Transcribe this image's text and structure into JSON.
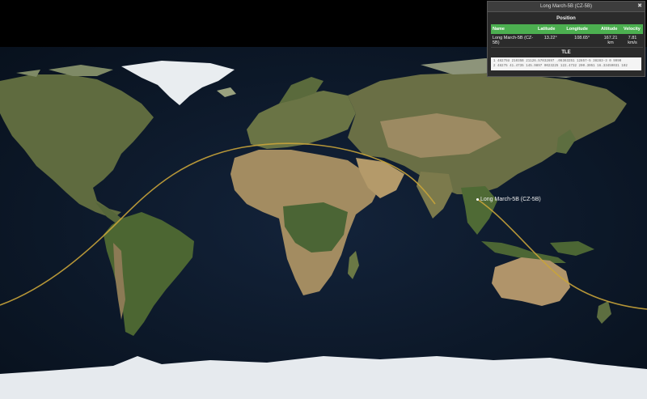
{
  "panel": {
    "title": "Long March-5B (CZ-5B)",
    "close_icon": "close-icon",
    "position_heading": "Position",
    "columns": [
      "Name",
      "Latitude",
      "Longitude",
      "Altitude",
      "Velocity"
    ],
    "row": {
      "name": "Long March-5B (CZ-5B)",
      "latitude": "13.22°",
      "longitude": "108.65°",
      "altitude": "167.21 km",
      "velocity": "7.81 km/s"
    },
    "tle_heading": "TLE",
    "tle_line1": "1 48275U 21035B   21126.57032697  .06363251  12857-5  38283-3 0  9990",
    "tle_line2": "2 48275  41.4735 145.9897 0023225 122.4732 200.3051 16.33459031   102"
  },
  "satellite_label": "Long March-5B (CZ-5B)",
  "colors": {
    "orbit": "#c9a43a",
    "ocean": "#0d1a2b",
    "land": "#5e6e3c",
    "desert": "#a8936a",
    "ice": "#e8ecef",
    "header_green": "#4caf50"
  }
}
